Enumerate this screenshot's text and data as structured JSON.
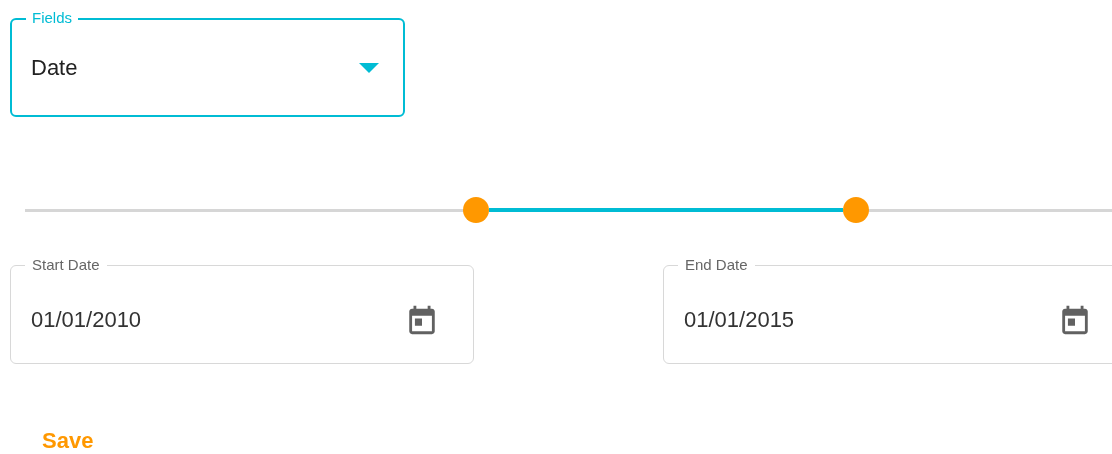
{
  "field_select": {
    "label": "Fields",
    "value": "Date"
  },
  "slider": {
    "thumbs": [
      {
        "level": 0.41
      },
      {
        "level": 0.755
      }
    ]
  },
  "date_fields": [
    {
      "label": "Start Date",
      "value": "01/01/2010"
    },
    {
      "label": "End Date",
      "value": "01/01/2015"
    }
  ],
  "save_button": {
    "label": "Save"
  }
}
